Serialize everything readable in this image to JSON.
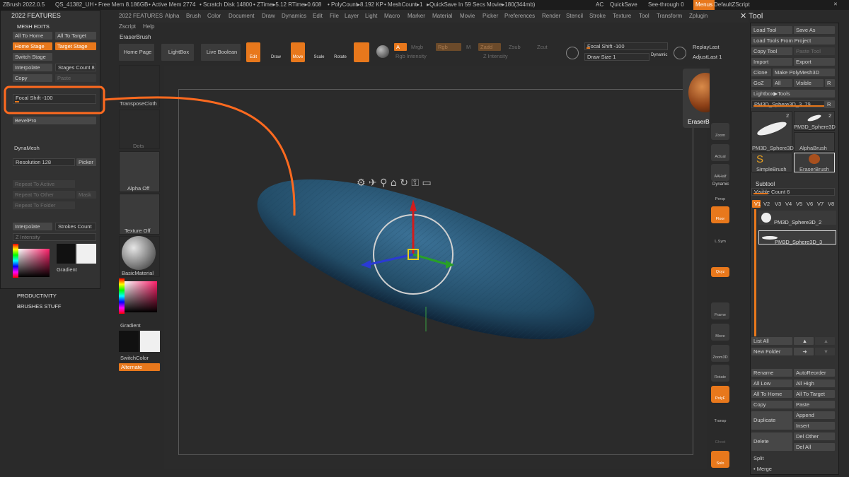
{
  "topbar": {
    "app": "ZBrush 2022.0.5",
    "doc": "QS_41382_UH",
    "stats": [
      "• Free Mem 8.186GB",
      "• Active Mem 2774",
      "• Scratch Disk 14800",
      "• ZTime▸5.12 RTime▸0.608",
      "• PolyCount▸8.192 KP",
      "• MeshCount▸1",
      "▸QuickSave In 59 Secs Movie▸180(344mb)"
    ],
    "ac": "AC",
    "quicksave": "QuickSave",
    "see_through": "See-through  0",
    "menus": "Menus",
    "script": "DefaultZScript"
  },
  "menubar": [
    "2022 FEATURES",
    "Alpha",
    "Brush",
    "Color",
    "Document",
    "Draw",
    "Dynamics",
    "Edit",
    "File",
    "Layer",
    "Light",
    "Macro",
    "Marker",
    "Material",
    "Movie",
    "Picker",
    "Preferences",
    "Render",
    "Stencil",
    "Stroke",
    "Texture",
    "Tool",
    "Transform",
    "Zplugin"
  ],
  "menubar2": [
    "Zscript",
    "Help"
  ],
  "brush_title": "EraserBrush",
  "left_panel": {
    "title": "2022 FEATURES",
    "section": "MESH EDITS",
    "buttons": {
      "all_to_home": "All To Home",
      "all_to_target": "All To Target",
      "home_stage": "Home Stage",
      "target_stage": "Target Stage",
      "switch_stage": "Switch Stage",
      "interpolate": "Interpolate",
      "stages_count": "Stages Count 8",
      "copy": "Copy",
      "paste": "Paste",
      "focal_shift": "Focal Shift -100",
      "bevelpro": "BevelPro",
      "dynamesh": "DynaMesh",
      "resolution": "Resolution 128",
      "picker": "Picker",
      "repeat_to_active": "Repeat To Active",
      "repeat_to_other": "Repeat To Other",
      "mask": "Mask",
      "repeat_to_folder": "Repeat To Folder",
      "interpolate2": "Interpolate",
      "strokes_count": "Strokes Count",
      "z_intensity": "Z Intensity",
      "gradient": "Gradient"
    },
    "productivity": "PRODUCTIVITY",
    "brushes_stuff": "BRUSHES STUFF"
  },
  "top_shelf": {
    "home_page": "Home Page",
    "lightbox": "LightBox",
    "live_boolean": "Live Boolean",
    "edit": "Edit",
    "draw": "Draw",
    "move": "Move",
    "scale": "Scale",
    "rotate": "Rotate",
    "a": "A",
    "mrgb": "Mrgb",
    "rgb": "Rgb",
    "m": "M",
    "zadd": "Zadd",
    "zsub": "Zsub",
    "zcut": "Zcut",
    "rgb_intensity": "Rgb Intensity",
    "z_intensity": "Z Intensity",
    "focal_shift": "Focal Shift -100",
    "draw_size": "Draw Size 1",
    "dynamic": "Dynamic",
    "replay_last": "ReplayLast",
    "adjust_last": "AdjustLast 1"
  },
  "left_shelf": {
    "transpose": "TransposeCloth",
    "dots": "Dots",
    "alpha_off": "Alpha Off",
    "texture_off": "Texture Off",
    "material": "BasicMaterial",
    "gradient": "Gradient",
    "switch_color": "SwitchColor",
    "alternate": "Alternate"
  },
  "brush_popup": "EraserBrush",
  "right_shelf": [
    "Zoom",
    "Actual",
    "AAHalf",
    "Persp",
    "Floor",
    "L.Sym",
    "Qxyz",
    "Frame",
    "Move",
    "Zoom3D",
    "Rotate",
    "PolyF",
    "Transp",
    "Ghost",
    "Solo"
  ],
  "right_shelf_dynamic": "Dynamic",
  "tool_panel": {
    "title": "Tool",
    "load_tool": "Load Tool",
    "save_as": "Save As",
    "load_from_project": "Load Tools From Project",
    "copy_tool": "Copy Tool",
    "paste_tool": "Paste Tool",
    "import": "Import",
    "export": "Export",
    "clone": "Clone",
    "make_polymesh": "Make PolyMesh3D",
    "goz": "GoZ",
    "all": "All",
    "visible": "Visible",
    "r": "R",
    "lightbox_tools": "Lightbox▶Tools",
    "current": "PM3D_Sphere3D_3. 79",
    "thumbs": [
      {
        "name": "PM3D_Sphere3D",
        "badge": "2"
      },
      {
        "name": "PM3D_Sphere3D",
        "badge": "2"
      },
      {
        "name": "AlphaBrush",
        "badge": ""
      },
      {
        "name": "SimpleBrush",
        "badge": ""
      },
      {
        "name": "EraserBrush",
        "badge": ""
      }
    ],
    "subtool": "Subtool",
    "visible_count": "Visible Count 6",
    "versions": [
      "V1",
      "V2",
      "V3",
      "V4",
      "V5",
      "V6",
      "V7",
      "V8"
    ],
    "subtools": [
      "PM3D_Sphere3D_2",
      "PM3D_Sphere3D_3"
    ],
    "list_all": "List All",
    "new_folder": "New Folder",
    "rename": "Rename",
    "auto_reorder": "AutoReorder",
    "all_low": "All Low",
    "all_high": "All High",
    "all_to_home": "All To Home",
    "all_to_target": "All To Target",
    "copy": "Copy",
    "paste": "Paste",
    "duplicate": "Duplicate",
    "append": "Append",
    "insert": "Insert",
    "delete": "Delete",
    "del_other": "Del Other",
    "del_all": "Del All",
    "split": "Split",
    "merge": "Merge"
  },
  "colors": {
    "accent": "#e8781c",
    "mesh": "#2f5d7a",
    "callout": "#ff6a1f"
  }
}
